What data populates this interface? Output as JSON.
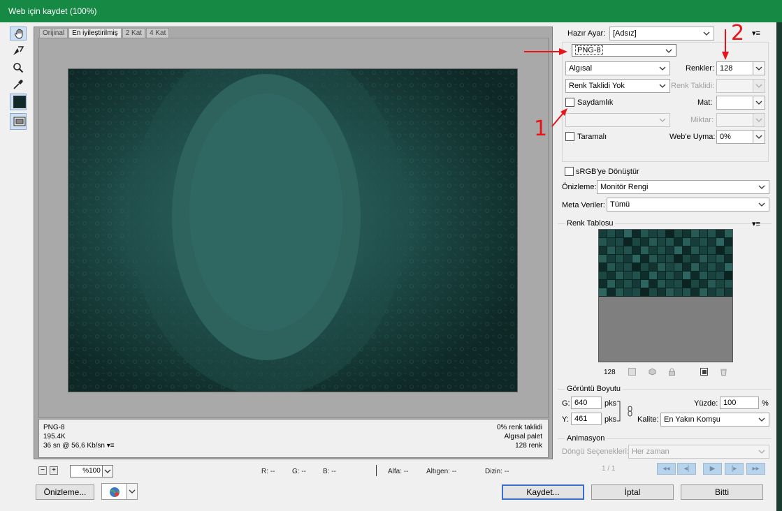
{
  "window": {
    "title": "Web için kaydet (100%)"
  },
  "tabs": [
    {
      "label": "Orijinal"
    },
    {
      "label": "En iyileştirilmiş"
    },
    {
      "label": "2 Kat"
    },
    {
      "label": "4 Kat"
    }
  ],
  "tools": [
    "hand-icon",
    "slice-select-icon",
    "zoom-icon",
    "eyedropper-icon",
    "color-swatch-icon",
    "toggle-slices-icon"
  ],
  "colors": {
    "accent": "#168a45",
    "image_bg": "#123330",
    "swatch_highlight": "#3b6fcf",
    "annotation_red": "#e8141a"
  },
  "info": {
    "format": "PNG-8",
    "size": "195.4K",
    "time": "36 sn @ 56,6 Kb/sn",
    "dither_pct": "0% renk taklidi",
    "palette": "Algısal palet",
    "colors": "128 renk"
  },
  "bottom": {
    "zoom": "%100",
    "r": "R: --",
    "g": "G: --",
    "b": "B: --",
    "alpha": "Alfa: --",
    "hex": "Altıgen: --",
    "index": "Dizin: --",
    "preview_btn": "Önizleme...",
    "save_btn": "Kaydet...",
    "cancel_btn": "İptal",
    "done_btn": "Bitti"
  },
  "settings": {
    "preset_label": "Hazır Ayar:",
    "preset_value": "[Adsız]",
    "format_value": "PNG-8",
    "reduction_value": "Algısal",
    "colors_label": "Renkler:",
    "colors_value": "128",
    "dither_value": "Renk Taklidi Yok",
    "dither_label": "Renk Taklidi:",
    "transparency_label": "Saydamlık",
    "matte_label": "Mat:",
    "amount_label": "Miktar:",
    "interlaced_label": "Taramalı",
    "websnap_label": "Web'e Uyma:",
    "websnap_value": "0%",
    "srgb_label": "sRGB'ye Dönüştür",
    "preview_label": "Önizleme:",
    "preview_value": "Monitör Rengi",
    "metadata_label": "Meta Veriler:",
    "metadata_value": "Tümü"
  },
  "color_table": {
    "title": "Renk Tablosu",
    "count": "128",
    "swatches": [
      "#163d3a",
      "#1d4a46",
      "#0f2d2b",
      "#245652",
      "#1a4541",
      "#2d6560",
      "#12332f",
      "#1f4f4b",
      "#0b2422",
      "#2a5e59",
      "#184240",
      "#21524e",
      "#0e2a28",
      "#275a55",
      "#143936",
      "#1c4844"
    ]
  },
  "image_size": {
    "title": "Görüntü Boyutu",
    "w_label": "G:",
    "w_value": "640",
    "h_label": "Y:",
    "h_value": "461",
    "unit": "pks",
    "percent_label": "Yüzde:",
    "percent_value": "100",
    "percent_unit": "%",
    "quality_label": "Kalite:",
    "quality_value": "En Yakın Komşu"
  },
  "animation": {
    "title": "Animasyon",
    "loop_label": "Döngü Seçenekleri:",
    "loop_value": "Her zaman",
    "frame": "1 / 1"
  },
  "annotations": {
    "one": "1",
    "two": "2"
  }
}
